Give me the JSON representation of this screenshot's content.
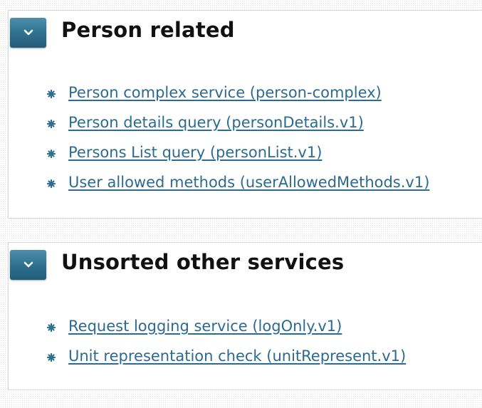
{
  "sections": [
    {
      "title": "Person related",
      "toggle_icon": "chevron-down-icon",
      "items": [
        {
          "label": "Person complex service (person-complex)"
        },
        {
          "label": "Person details query (personDetails.v1)"
        },
        {
          "label": "Persons List query (personList.v1)"
        },
        {
          "label": "User allowed methods (userAllowedMethods.v1)"
        }
      ]
    },
    {
      "title": "Unsorted other services",
      "toggle_icon": "chevron-down-icon",
      "items": [
        {
          "label": "Request logging service (logOnly.v1)"
        },
        {
          "label": "Unit representation check (unitRepresent.v1)"
        }
      ]
    }
  ],
  "colors": {
    "link": "#2b6a91",
    "toggle": "#2f6f8e",
    "bullet": "#2f6f8e",
    "title": "#111111"
  },
  "icons": {
    "bullet": "asterisk-bullet-icon",
    "toggle": "chevron-down-icon"
  }
}
